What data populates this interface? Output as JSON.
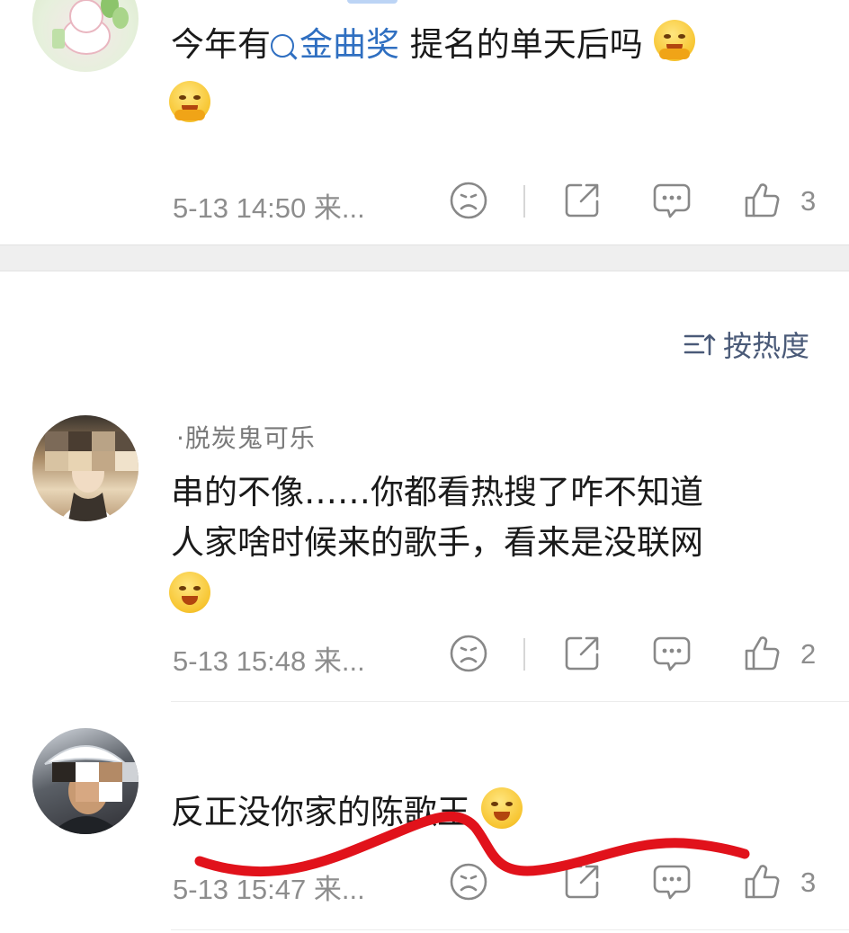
{
  "sort": {
    "label": "按热度"
  },
  "comments": [
    {
      "username": "",
      "text_before": "今年有",
      "search_term": "金曲奖",
      "text_after": " 提名的单天后吗",
      "time": "5-13 14:50",
      "source": "来...",
      "likes": "3"
    },
    {
      "username": "·脱炭鬼可乐",
      "line1": "串的不像……你都看热搜了咋不知道",
      "line2": "人家啥时候来的歌手，看来是没联网",
      "time": "5-13 15:48",
      "source": "来...",
      "likes": "2"
    },
    {
      "username": "",
      "text": "反正没你家的陈歌王",
      "time": "5-13 15:47",
      "source": "来...",
      "likes": "3"
    }
  ],
  "icons": {
    "dislike": "frown-face-icon",
    "share": "share-out-icon",
    "reply": "chat-bubble-icon",
    "like": "thumbs-up-icon",
    "sort": "sort-lines-icon",
    "search": "search-icon"
  },
  "colors": {
    "link": "#2f6fc1",
    "meta": "#8d8d8d",
    "annotation_stroke": "#e1121b",
    "sort_text": "#4a5a78"
  }
}
